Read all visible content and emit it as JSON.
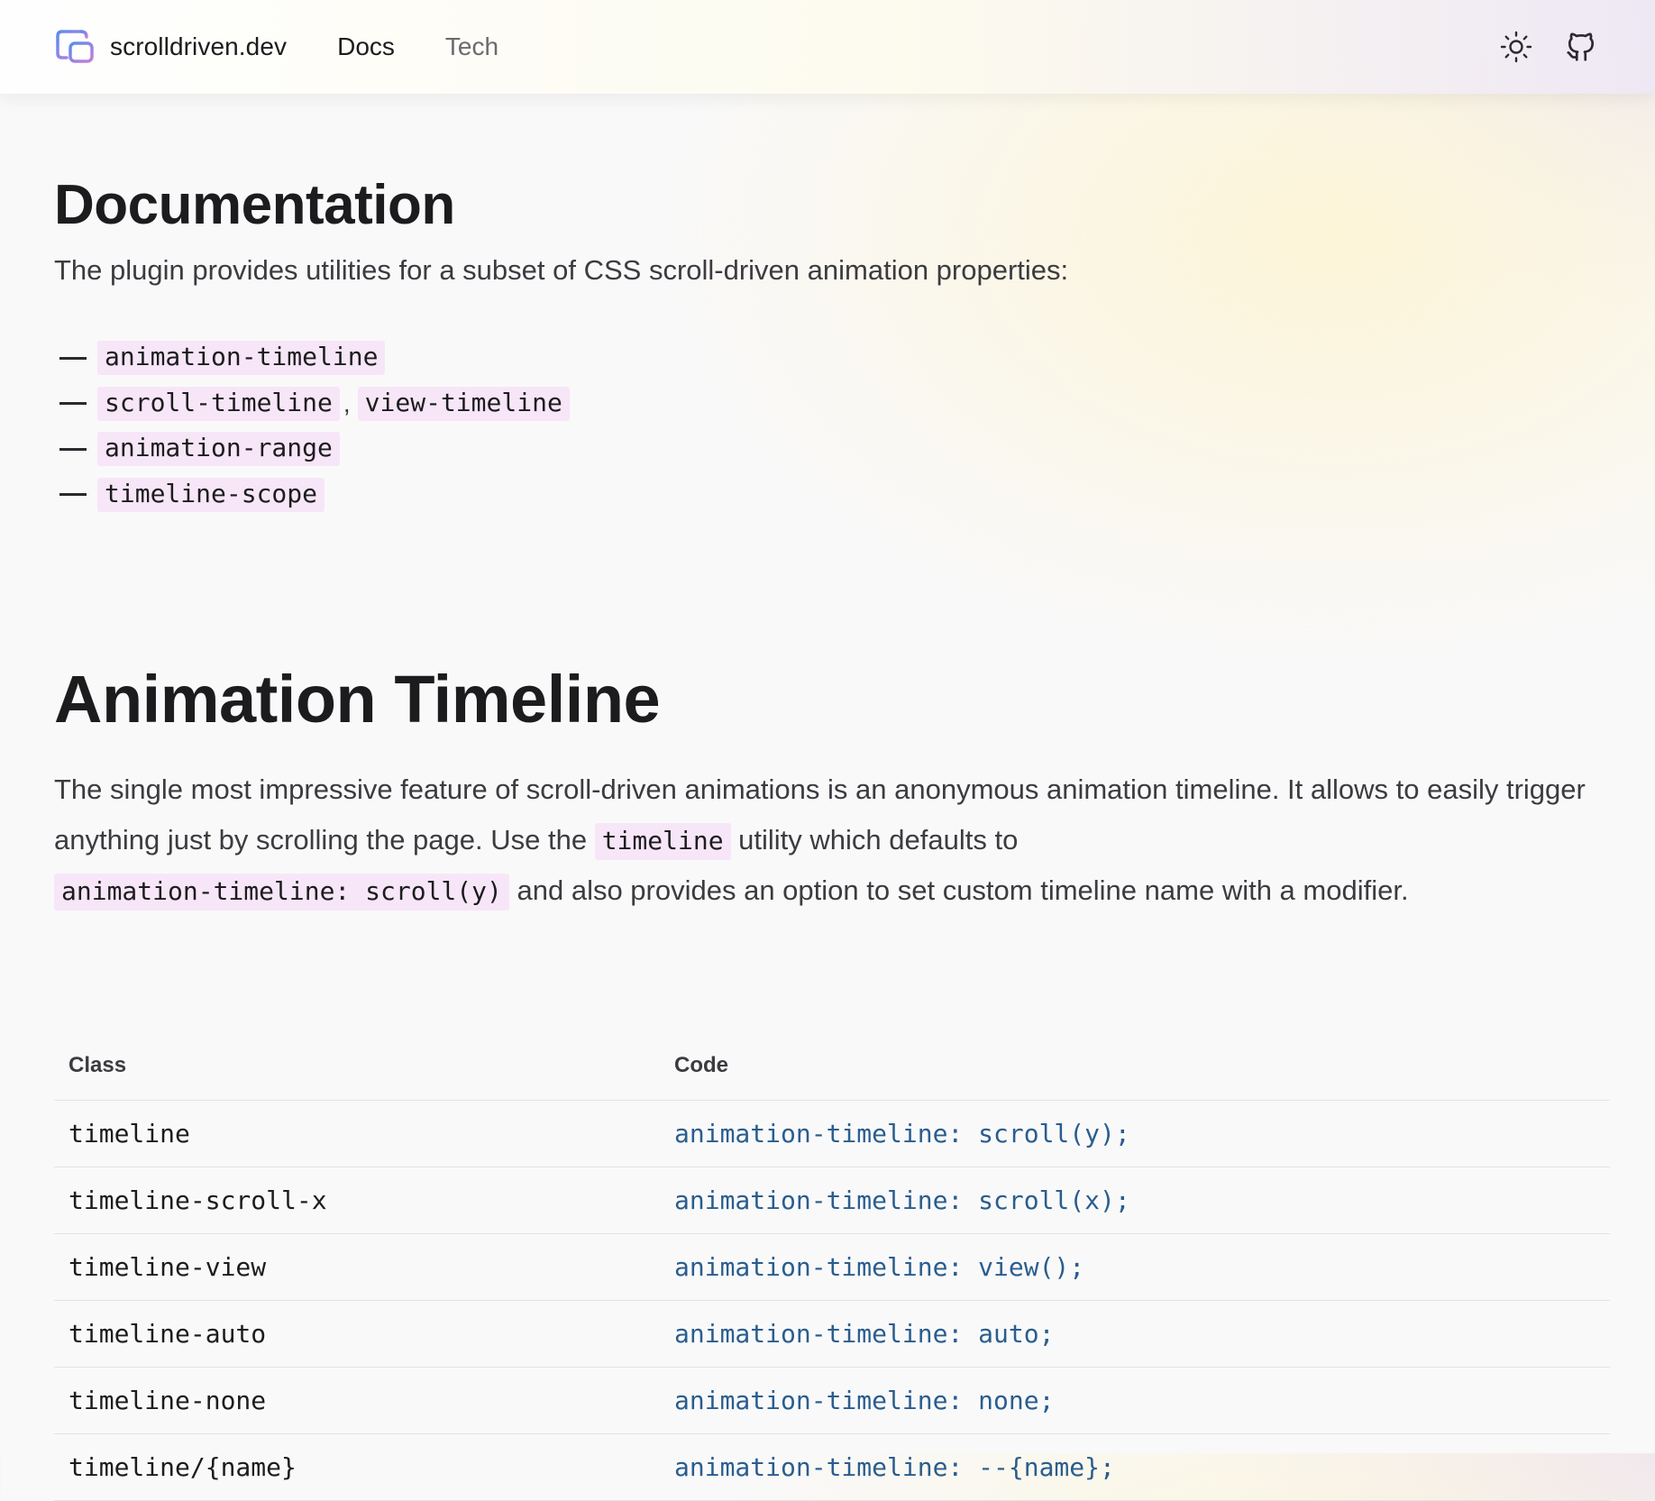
{
  "header": {
    "brand": "scrolldriven.dev",
    "nav": [
      {
        "label": "Docs",
        "active": true
      },
      {
        "label": "Tech",
        "active": false
      }
    ],
    "icons": [
      "sun-icon",
      "github-icon"
    ]
  },
  "documentation": {
    "title": "Documentation",
    "intro": "The plugin provides utilities for a subset of CSS scroll-driven animation properties:",
    "properties": [
      [
        "animation-timeline"
      ],
      [
        "scroll-timeline",
        "view-timeline"
      ],
      [
        "animation-range"
      ],
      [
        "timeline-scope"
      ]
    ],
    "separator": ","
  },
  "animation_timeline": {
    "title": "Animation Timeline",
    "paragraph": {
      "part1": "The single most impressive feature of scroll-driven animations is an anonymous animation timeline. It allows to easily trigger anything just by scrolling the page. Use the ",
      "code1": "timeline",
      "part2": " utility which defaults to ",
      "code2": "animation-timeline: scroll(y)",
      "part3": " and also provides an option to set custom timeline name with a modifier."
    },
    "table": {
      "headers": [
        "Class",
        "Code"
      ],
      "rows": [
        {
          "class": "timeline",
          "code": "animation-timeline: scroll(y);"
        },
        {
          "class": "timeline-scroll-x",
          "code": "animation-timeline: scroll(x);"
        },
        {
          "class": "timeline-view",
          "code": "animation-timeline: view();"
        },
        {
          "class": "timeline-auto",
          "code": "animation-timeline: auto;"
        },
        {
          "class": "timeline-none",
          "code": "animation-timeline: none;"
        },
        {
          "class": "timeline/{name}",
          "code": "animation-timeline: --{name};"
        }
      ]
    }
  },
  "colors": {
    "code_pill_bg": "#f7e6f7",
    "code_text": "#2a5d8e",
    "logo_gradient": [
      "#5b8def",
      "#c77dd8"
    ]
  }
}
